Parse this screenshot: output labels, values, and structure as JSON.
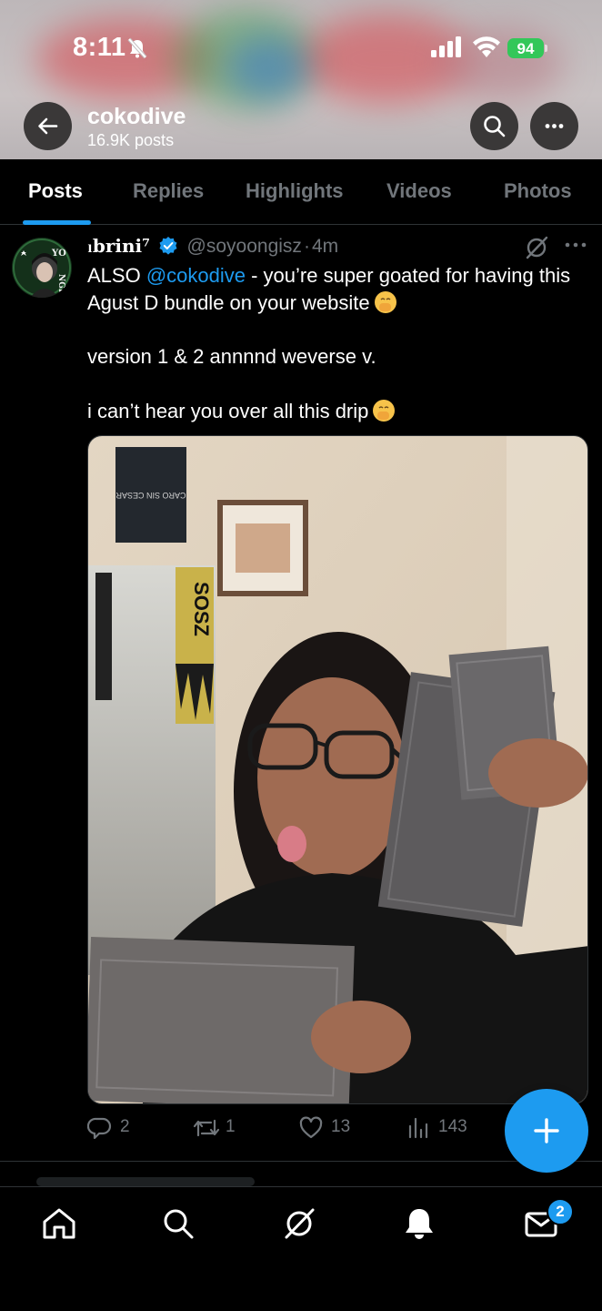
{
  "status_bar": {
    "time": "8:11",
    "battery": "94"
  },
  "header": {
    "profile_name": "cokodive",
    "post_count": "16.9K posts"
  },
  "tabs": [
    {
      "label": "Posts",
      "active": true
    },
    {
      "label": "Replies",
      "active": false
    },
    {
      "label": "Highlights",
      "active": false
    },
    {
      "label": "Videos",
      "active": false
    },
    {
      "label": "Photos",
      "active": false
    }
  ],
  "tweet": {
    "display_name": "ₗbrini⁷",
    "handle": "@soyoongisz",
    "separator": "·",
    "time": "4m",
    "text_line1_prefix": "ALSO ",
    "mention": "@cokodive",
    "text_line1_suffix": " - you’re super goated for having this Agust D bundle on your website",
    "text_line2": "version 1 & 2 annnnd weverse v.",
    "text_line3": "i can’t hear you over all this drip",
    "avatar_text": "YOONGI",
    "media_scarf_text": "SOSZ",
    "media_sign_text": "CARO SIN CESAR",
    "stats": {
      "replies": "2",
      "reposts": "1",
      "likes": "13",
      "views": "143"
    }
  },
  "bottom_nav": {
    "messages_badge": "2"
  },
  "colors": {
    "accent": "#1d9bf0",
    "background": "#000000",
    "muted_text": "#71767b",
    "battery_green": "#33c759"
  },
  "icons": [
    "back-arrow-icon",
    "search-icon",
    "more-icon",
    "verified-icon",
    "grok-icon",
    "reply-icon",
    "repost-icon",
    "like-icon",
    "views-icon",
    "compose-plus-icon",
    "home-icon",
    "explore-icon",
    "notifications-icon",
    "messages-icon"
  ]
}
